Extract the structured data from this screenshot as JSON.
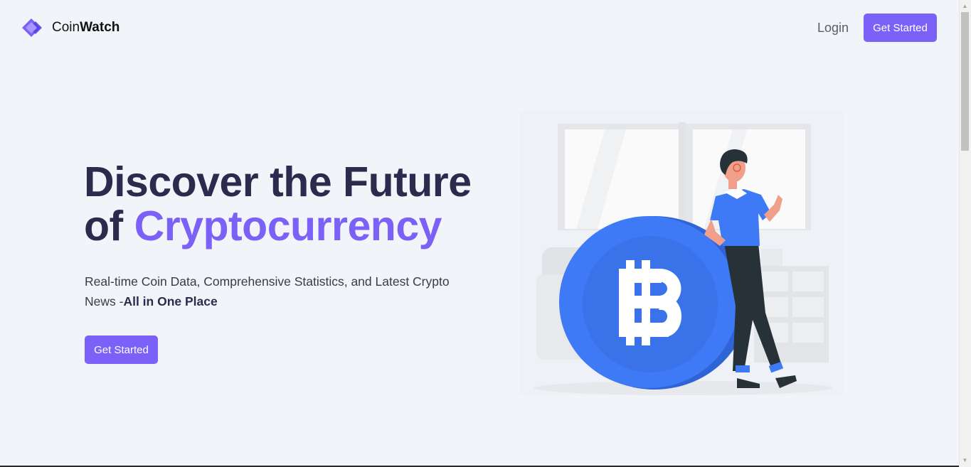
{
  "brand": {
    "name_light": "Coin",
    "name_bold": "Watch"
  },
  "nav": {
    "login_label": "Login",
    "cta_label": "Get Started"
  },
  "hero": {
    "title_line1": "Discover the Future",
    "title_of": "of ",
    "title_accent": "Cryptocurrency",
    "subtitle": "Real-time Coin Data, Comprehensive Statistics, and Latest Crypto News -",
    "subtitle_bold": "All in One Place",
    "cta_label": "Get Started"
  },
  "colors": {
    "accent": "#7b61f7",
    "background": "#f1f4f9",
    "coin": "#3f7af6",
    "title": "#2d2b4d"
  },
  "icons": [
    "logo-diamond-icon",
    "bitcoin-icon",
    "scroll-up-icon",
    "scroll-down-icon"
  ]
}
